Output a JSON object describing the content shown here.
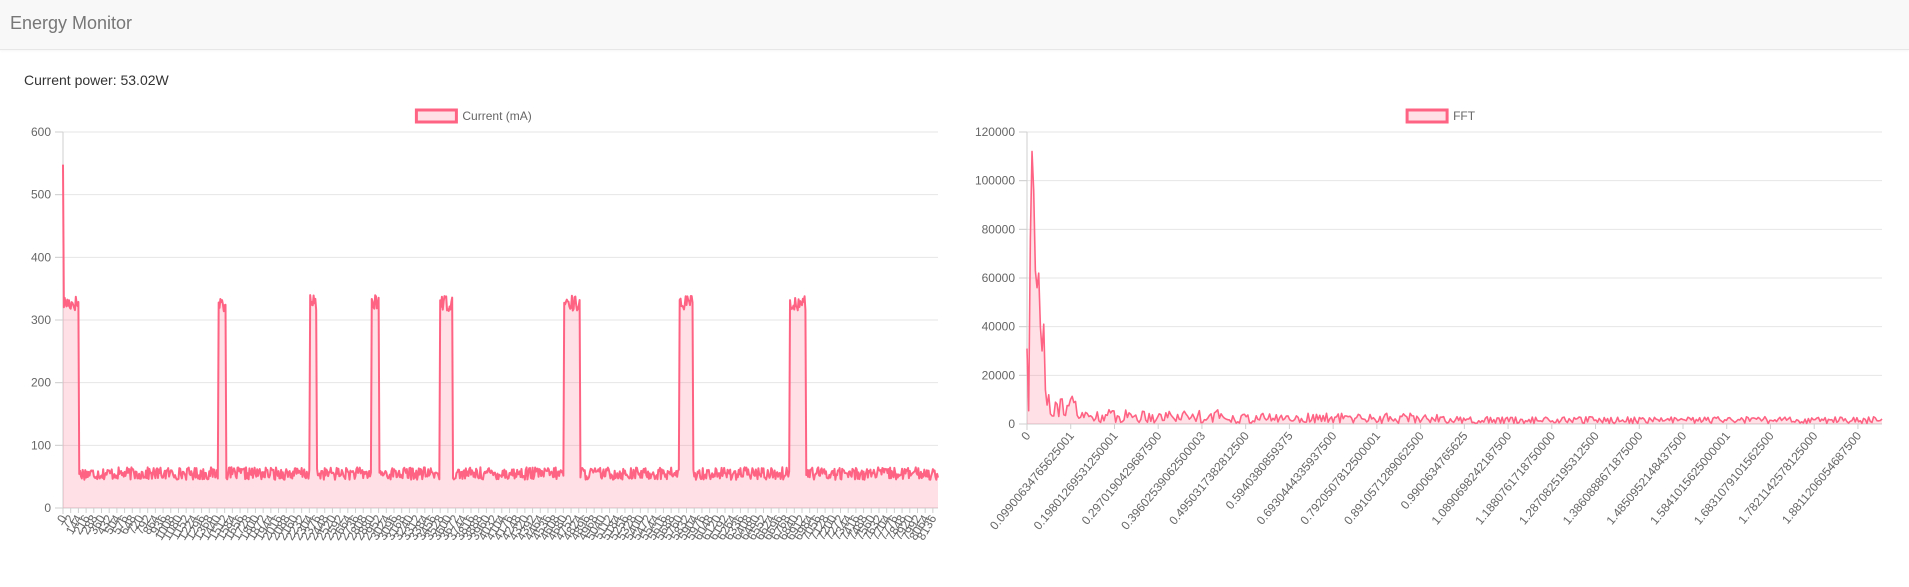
{
  "app": {
    "title": "Energy Monitor"
  },
  "status": {
    "label": "Current power:",
    "value": "53.02W"
  },
  "chart_data": [
    {
      "type": "line",
      "series": [
        {
          "name": "Current (mA)",
          "color": "#ff6384",
          "fill": "rgba(255,99,132,0.2)"
        }
      ],
      "ylim": [
        0,
        600
      ],
      "yticks": [
        "0",
        "100",
        "200",
        "300",
        "400",
        "500",
        "600"
      ],
      "x_count": 1024,
      "x_step": 8,
      "x_tick_stride": 9,
      "baseline": 55,
      "high": 327,
      "spike_start": 548,
      "high_segments": [
        [
          0,
          18
        ],
        [
          182,
          190
        ],
        [
          289,
          296
        ],
        [
          361,
          369
        ],
        [
          441,
          455
        ],
        [
          586,
          604
        ],
        [
          721,
          736
        ],
        [
          850,
          868
        ]
      ],
      "grid": true,
      "legend": "top"
    },
    {
      "type": "area",
      "series": [
        {
          "name": "FFT",
          "color": "#ff6384",
          "fill": "rgba(255,99,132,0.2)"
        }
      ],
      "ylim": [
        0,
        120000
      ],
      "yticks": [
        "0",
        "20000",
        "40000",
        "60000",
        "80000",
        "100000",
        "120000"
      ],
      "xticks": [
        "0",
        "0.09900634765625001",
        "0.19801269531250001",
        "0.2970190429687500",
        "0.39602539062500003",
        "0.4950317382812500",
        "0.5940380859375",
        "0.6930444335937500",
        "0.7920507812500001",
        "0.8910571289062500",
        "0.9900634765625",
        "1.0890698242187500",
        "1.1880761718750000",
        "1.2870825195312500",
        "1.3860888671875000",
        "1.4850952148437500",
        "1.5841015625000001",
        "1.6831079101562500",
        "1.7821142578125000",
        "1.8811206054687500"
      ],
      "peaks": [
        [
          0,
          31000
        ],
        [
          2,
          76000
        ],
        [
          3,
          112000
        ],
        [
          4,
          96000
        ],
        [
          5,
          63000
        ],
        [
          6,
          56000
        ],
        [
          7,
          62000
        ],
        [
          8,
          40000
        ],
        [
          9,
          30000
        ],
        [
          10,
          41000
        ],
        [
          11,
          14000
        ],
        [
          13,
          12000
        ]
      ],
      "grid": true,
      "legend": "top"
    }
  ]
}
